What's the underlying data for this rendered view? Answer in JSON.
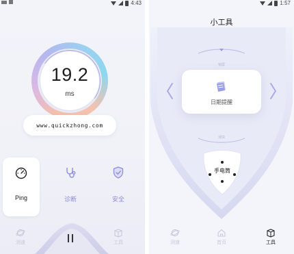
{
  "left_screen": {
    "status_bar": {
      "time": "4:43"
    },
    "ping_display": {
      "value": "19.2",
      "unit": "ms"
    },
    "url": "www.quickzhong.com",
    "features": [
      {
        "label": "Ping",
        "icon": "speedometer-icon",
        "selected": true
      },
      {
        "label": "诊断",
        "icon": "stethoscope-icon",
        "selected": false
      },
      {
        "label": "安全",
        "icon": "shield-check-icon",
        "selected": false
      }
    ],
    "nav": [
      {
        "label": "测速",
        "icon": "planet-icon"
      },
      {
        "label": "工具",
        "icon": "box-icon"
      }
    ],
    "control": {
      "icon": "pause-icon"
    }
  },
  "right_screen": {
    "status_bar": {
      "time": "1:57"
    },
    "title": "小工具",
    "top_label": "锁屏",
    "bottom_label": "滑块",
    "selected_tool": {
      "label": "日期提醒",
      "icon": "calendar-icon"
    },
    "flashlight": {
      "label": "手电筒"
    },
    "nav": [
      {
        "label": "测速",
        "icon": "planet-icon",
        "active": false
      },
      {
        "label": "首页",
        "icon": "home-icon",
        "active": false
      },
      {
        "label": "工具",
        "icon": "box-icon",
        "active": true
      }
    ]
  },
  "colors": {
    "accent": "#8c8ce0",
    "ring_warm": "#f6c0a8",
    "ring_cool": "#9ccff0"
  }
}
